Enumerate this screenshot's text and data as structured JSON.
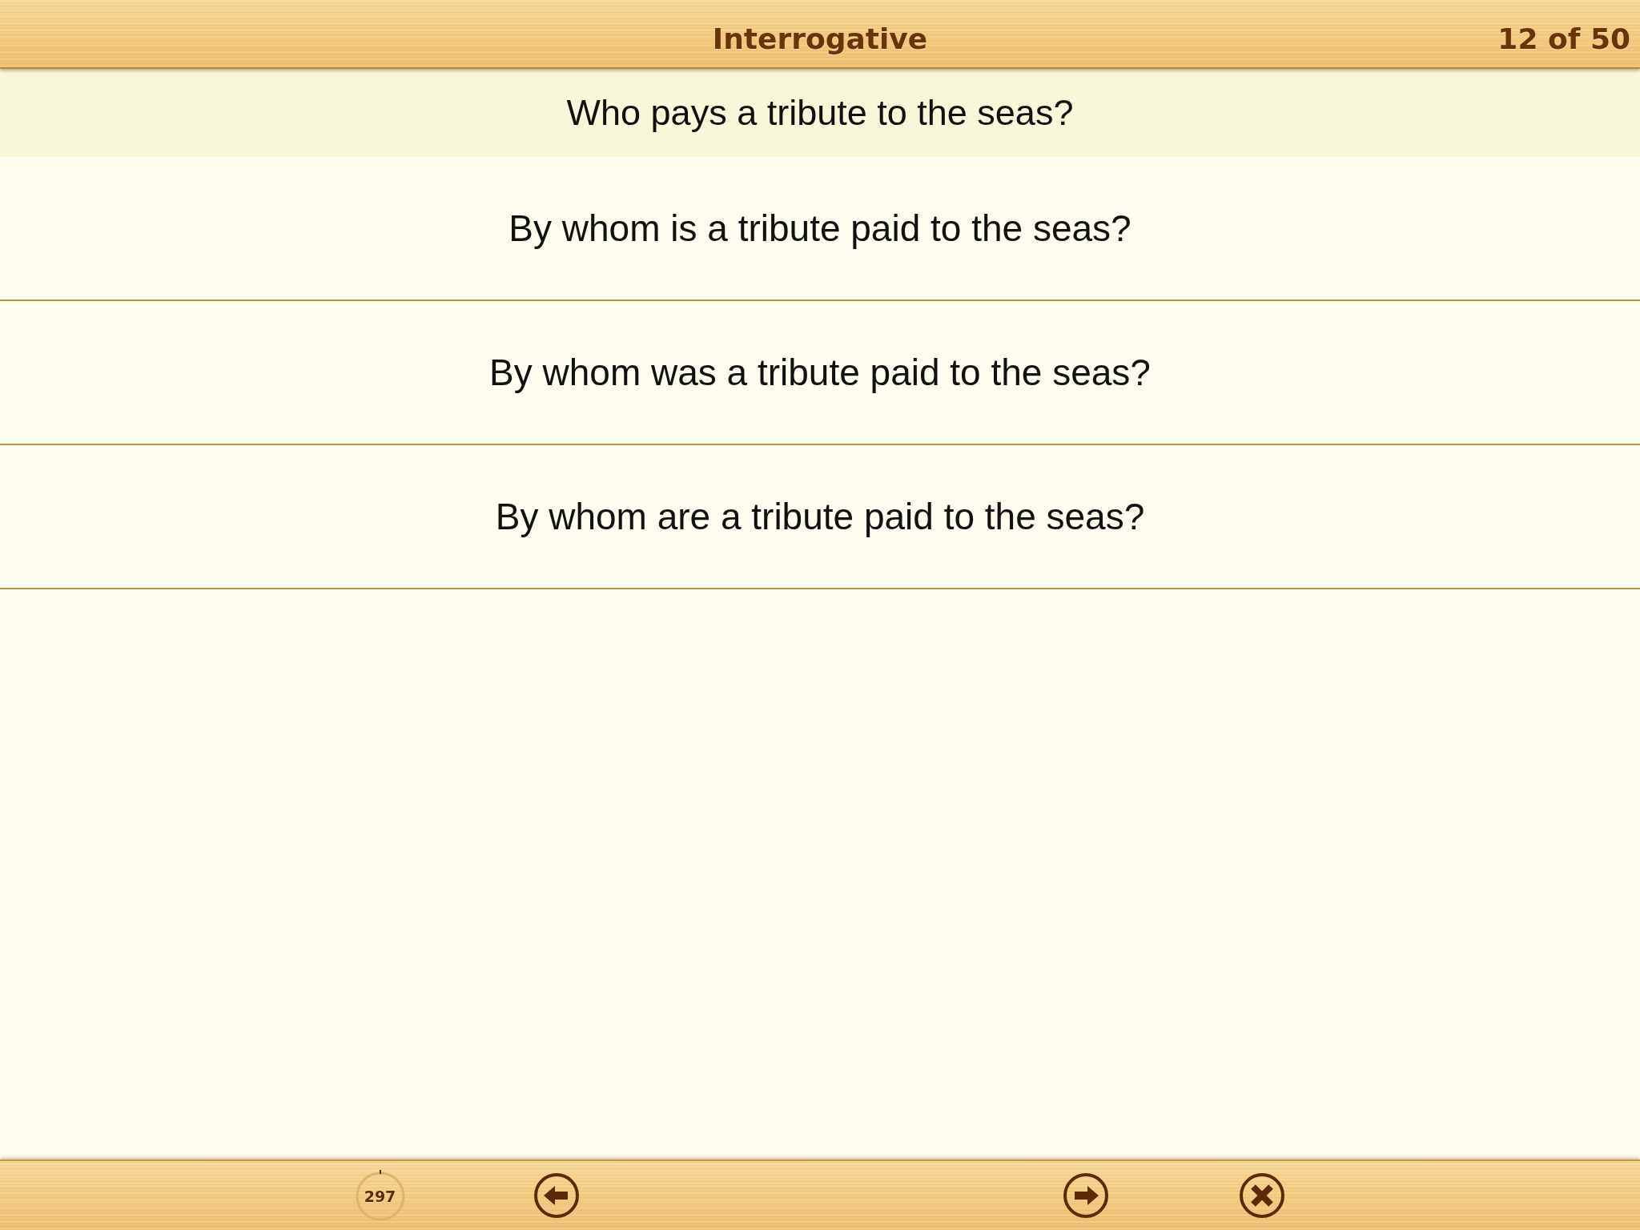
{
  "header": {
    "title": "Interrogative",
    "counter": "12 of 50"
  },
  "question": "Who pays a tribute to the seas?",
  "options": [
    "By whom is a tribute paid to the seas?",
    "By whom was a tribute paid to the seas?",
    "By whom are a tribute paid to the seas?"
  ],
  "timer": {
    "value": "297"
  }
}
